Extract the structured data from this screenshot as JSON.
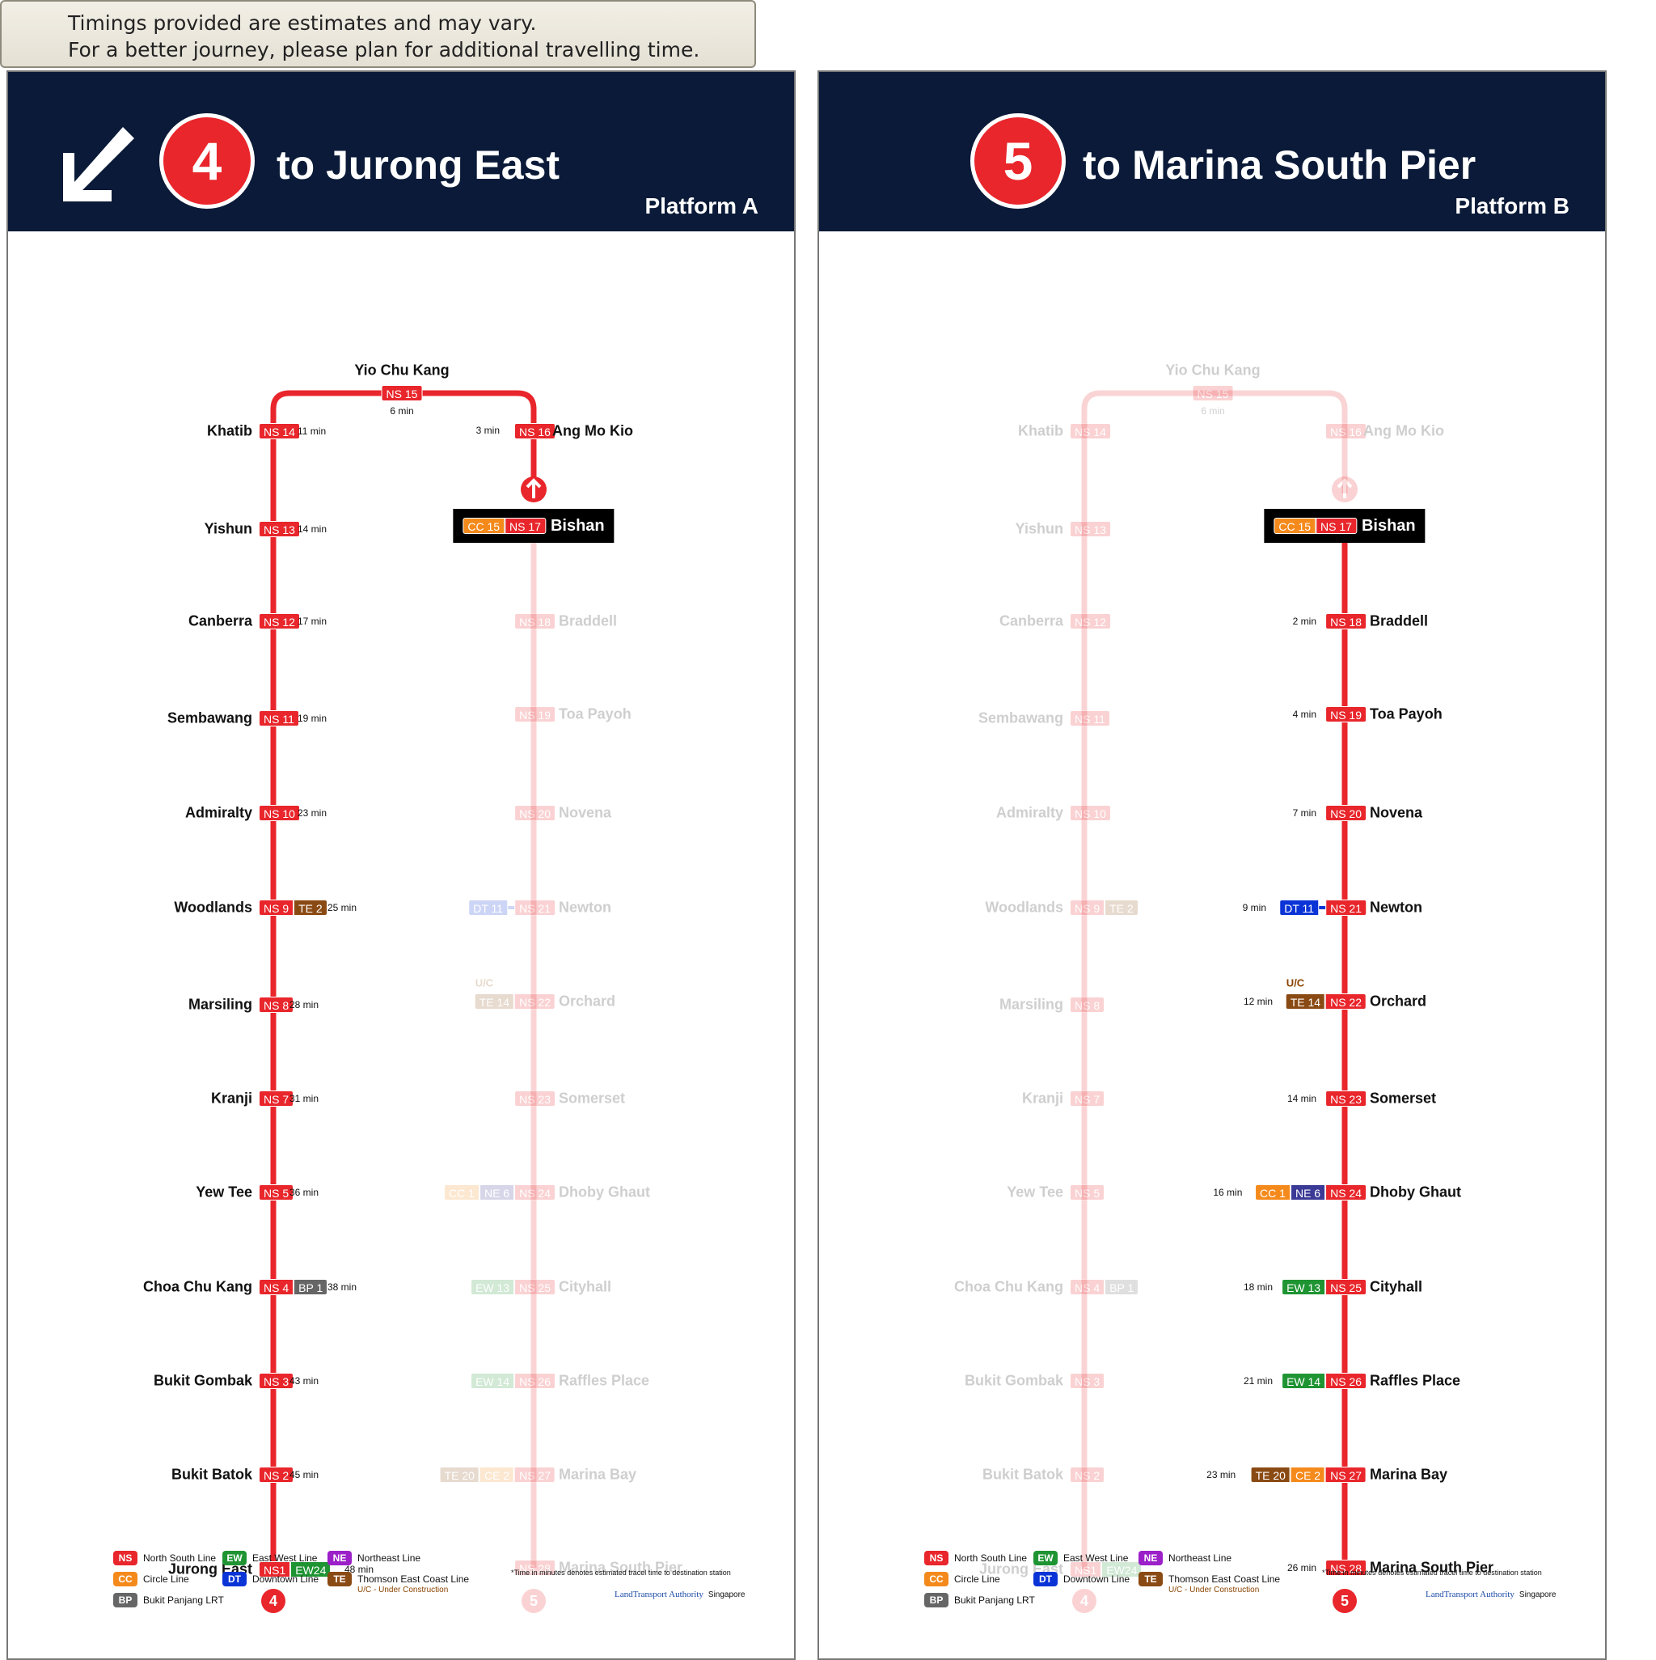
{
  "notice": {
    "line1": "Timings provided are estimates and may vary.",
    "line2": "For a better journey, please plan for additional travelling time."
  },
  "colors": {
    "NS": "#e8262b",
    "EW": "#1f9433",
    "NE": "#9b20c8",
    "CC": "#f58a1c",
    "DT": "#0a34d6",
    "TE": "#8a4a13",
    "BP": "#666666",
    "NE_badge": "#3b3a96",
    "header": "#0a1a38"
  },
  "terminal": {
    "name": "Yio Chu Kang",
    "code": "NS 15",
    "time": "6 min"
  },
  "west_stations": [
    {
      "name": "Khatib",
      "codes": [
        "NS 14"
      ],
      "time": "11 min"
    },
    {
      "name": "Yishun",
      "codes": [
        "NS 13"
      ],
      "time": "14 min"
    },
    {
      "name": "Canberra",
      "codes": [
        "NS 12"
      ],
      "time": "17 min"
    },
    {
      "name": "Sembawang",
      "codes": [
        "NS 11"
      ],
      "time": "19 min"
    },
    {
      "name": "Admiralty",
      "codes": [
        "NS 10"
      ],
      "time": "23 min"
    },
    {
      "name": "Woodlands",
      "codes": [
        "NS 9",
        "TE 2"
      ],
      "time": "25 min"
    },
    {
      "name": "Marsiling",
      "codes": [
        "NS 8"
      ],
      "time": "28 min"
    },
    {
      "name": "Kranji",
      "codes": [
        "NS 7"
      ],
      "time": "31 min"
    },
    {
      "name": "Yew Tee",
      "codes": [
        "NS 5"
      ],
      "time": "36 min"
    },
    {
      "name": "Choa Chu Kang",
      "codes": [
        "NS 4",
        "BP 1"
      ],
      "time": "38 min"
    },
    {
      "name": "Bukit Gombak",
      "codes": [
        "NS 3"
      ],
      "time": "43 min"
    },
    {
      "name": "Bukit Batok",
      "codes": [
        "NS 2"
      ],
      "time": "45 min"
    },
    {
      "name": "Jurong East",
      "codes": [
        "NS1",
        "EW24"
      ],
      "time": "48 min"
    }
  ],
  "ang_mo_kio": {
    "name": "Ang Mo Kio",
    "code": "NS 16",
    "time": "3 min"
  },
  "bishan": {
    "name": "Bishan",
    "codes": [
      "CC 15",
      "NS 17"
    ]
  },
  "east_stations": [
    {
      "name": "Braddell",
      "codes": [
        "NS 18"
      ],
      "time": "2 min"
    },
    {
      "name": "Toa Payoh",
      "codes": [
        "NS 19"
      ],
      "time": "4 min"
    },
    {
      "name": "Novena",
      "codes": [
        "NS 20"
      ],
      "time": "7 min"
    },
    {
      "name": "Newton",
      "codes": [
        "DT 11",
        "NS 21"
      ],
      "time": "9 min",
      "linked": true
    },
    {
      "name": "Orchard",
      "codes": [
        "TE 14",
        "NS 22"
      ],
      "time": "12 min",
      "uc": "U/C"
    },
    {
      "name": "Somerset",
      "codes": [
        "NS 23"
      ],
      "time": "14 min"
    },
    {
      "name": "Dhoby Ghaut",
      "codes": [
        "CC 1",
        "NE 6",
        "NS 24"
      ],
      "time": "16 min"
    },
    {
      "name": "Cityhall",
      "codes": [
        "EW 13",
        "NS 25"
      ],
      "time": "18 min"
    },
    {
      "name": "Raffles Place",
      "codes": [
        "EW 14",
        "NS 26"
      ],
      "time": "21 min"
    },
    {
      "name": "Marina Bay",
      "codes": [
        "TE 20",
        "CE 2",
        "NS 27"
      ],
      "time": "23 min"
    },
    {
      "name": "Marina South Pier",
      "codes": [
        "NS 28"
      ],
      "time": "26 min"
    }
  ],
  "panels": [
    {
      "id": "A",
      "route": "4",
      "destination": "to Jurong East",
      "platform": "Platform A",
      "arrow": "down-left-arrow"
    },
    {
      "id": "B",
      "route": "5",
      "destination": "to Marina South Pier",
      "platform": "Platform B",
      "arrow": ""
    }
  ],
  "legend": {
    "items": [
      {
        "code": "NS",
        "label": "North South Line"
      },
      {
        "code": "EW",
        "label": "East West Line"
      },
      {
        "code": "NE",
        "label": "Northeast Line"
      },
      {
        "code": "CC",
        "label": "Circle Line"
      },
      {
        "code": "DT",
        "label": "Downtown Line"
      },
      {
        "code": "TE",
        "label": "Thomson East Coast Line"
      },
      {
        "code": "BP",
        "label": "Bukit Panjang LRT"
      }
    ],
    "uc_note": "U/C - Under Construction",
    "time_note": "*Time in minutes denotes estimated tracel time to destination station",
    "lta_name": "LandTransport Authority",
    "lta_country": "Singapore"
  }
}
